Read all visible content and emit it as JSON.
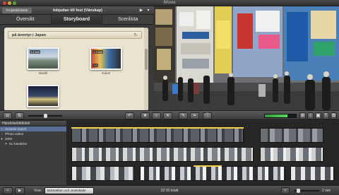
{
  "window": {
    "title": "iMovie"
  },
  "project": {
    "library_button": "Projektbibliotek",
    "name": "Inbjudan till fest (Vänskap)",
    "tabs": [
      {
        "label": "Översikt"
      },
      {
        "label": "Storyboard"
      },
      {
        "label": "Scenlista"
      }
    ],
    "active_tab": "Storyboard",
    "chapter_title": "på äventyr i Japan",
    "clips": [
      {
        "caption": "Model",
        "duration": "1,1 sek"
      },
      {
        "caption": "Action",
        "duration": "1,3 sek",
        "badge": "7.0"
      },
      {
        "caption": "",
        "duration": ""
      }
    ]
  },
  "event_library": {
    "header": "Händelsebibliotek",
    "items": [
      {
        "label": "Senaste import",
        "icon": "film-icon",
        "selected": true
      },
      {
        "label": "iPhoto-videor",
        "icon": "photo-icon",
        "selected": false
      },
      {
        "label": "2009",
        "icon": "folder-icon",
        "selected": false
      },
      {
        "label": "Nu händelse",
        "icon": "star-icon",
        "selected": false
      }
    ]
  },
  "bottom_bar": {
    "show_label": "Visa:",
    "filter_value": "Bokmärken och ometskade",
    "status": "22:16 totalt",
    "zoom_label": "2 sek"
  },
  "audio_meter": {
    "level": 0.72
  },
  "colors": {
    "storyboard_bg": "#e9e3cf",
    "selection": "#5a6f95",
    "meter_green": "#5fd65f"
  }
}
